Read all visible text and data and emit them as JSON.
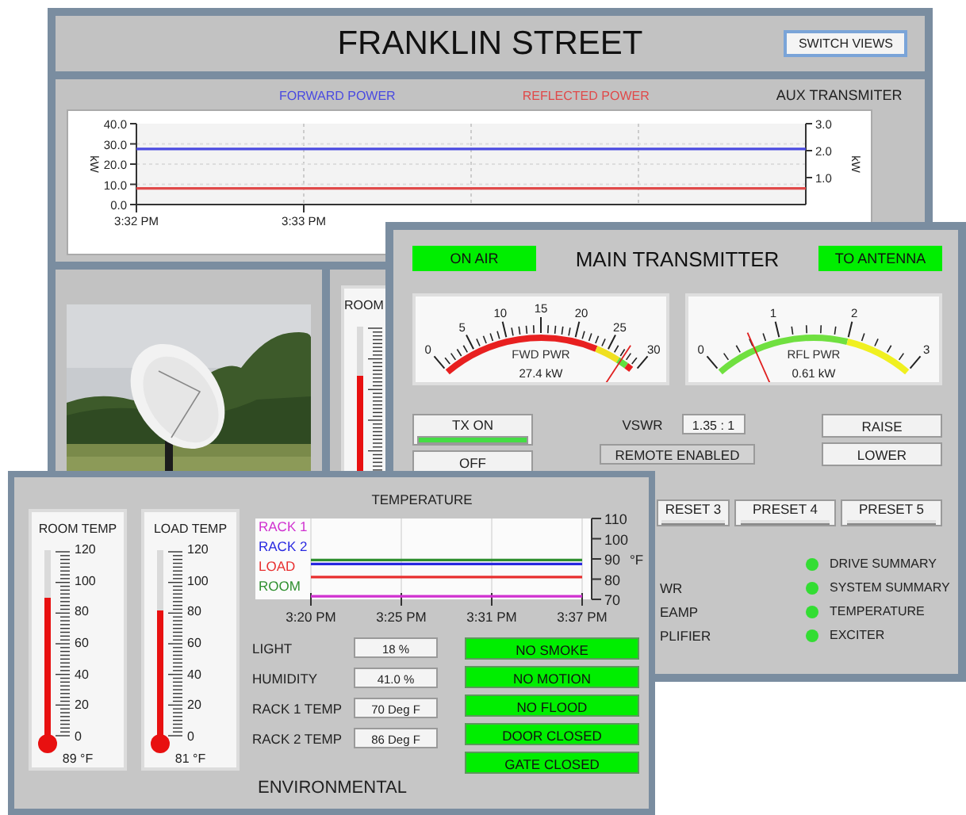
{
  "site_window": {
    "title": "FRANKLIN STREET",
    "switch_views_button": "SWITCH VIEWS",
    "aux_transmitter": {
      "title": "AUX TRANSMITER",
      "chart_data": {
        "type": "line",
        "grid": true,
        "ylabel": "kW",
        "y2label": "kW",
        "categories": [
          "3:32 PM",
          "3:33 PM",
          null,
          null,
          null
        ],
        "ylim": [
          0,
          40
        ],
        "yticks": [
          {
            "value": 0,
            "label": "0.0"
          },
          {
            "value": 10,
            "label": "10.0"
          },
          {
            "value": 20,
            "label": "20.0"
          },
          {
            "value": 30,
            "label": "30.0"
          },
          {
            "value": 40,
            "label": "40.0"
          }
        ],
        "y2lim": [
          0,
          3
        ],
        "y2ticks": [
          {
            "value": 1,
            "label": "1.0"
          },
          {
            "value": 2,
            "label": "2.0"
          },
          {
            "value": 3,
            "label": "3.0"
          }
        ],
        "series": [
          {
            "name": "FORWARD POWER",
            "color": "#4a4ae0",
            "values": [
              27.5,
              27.5,
              27.5,
              27.5,
              27.5
            ]
          },
          {
            "name": "REFLECTED POWER",
            "color": "#e04a4a",
            "axis": "y2",
            "values": [
              0.6,
              0.6,
              0.6,
              0.6,
              0.6
            ]
          }
        ]
      }
    },
    "room_thermometer": {
      "label": "ROOM",
      "level": 0.74
    }
  },
  "transmitter_window": {
    "title": "MAIN TRANSMITTER",
    "on_air": {
      "label": "ON AIR",
      "on": true
    },
    "to_antenna": {
      "label": "TO ANTENNA",
      "on": true
    },
    "gauges": [
      {
        "kind": "forward",
        "label": "FWD PWR",
        "reading": "27.4 kW",
        "ticks": [
          "0",
          "5",
          "10",
          "15",
          "20",
          "25",
          "30"
        ]
      },
      {
        "kind": "reflected",
        "label": "RFL PWR",
        "reading": "0.61 kW",
        "ticks": [
          "0",
          "1",
          "2",
          "3"
        ]
      }
    ],
    "tx_on_button": {
      "label": "TX ON",
      "on": true
    },
    "off_button": "OFF",
    "vswr_label": "VSWR",
    "vswr_value": "1.35 : 1",
    "remote_button": "REMOTE ENABLED",
    "raise_button": "RAISE",
    "lower_button": "LOWER",
    "presets": [
      {
        "label": "RESET 3",
        "on": false
      },
      {
        "label": "PRESET 4",
        "on": false
      },
      {
        "label": "PRESET 5",
        "on": false
      }
    ],
    "partial_labels": [
      "WR",
      "EAMP",
      "PLIFIER"
    ],
    "status_lights": [
      {
        "label": "DRIVE SUMMARY",
        "on": true
      },
      {
        "label": "SYSTEM SUMMARY",
        "on": true
      },
      {
        "label": "TEMPERATURE",
        "on": true
      },
      {
        "label": "EXCITER",
        "on": true
      }
    ]
  },
  "environment_window": {
    "title": "ENVIRONMENTAL",
    "thermometers": [
      {
        "label": "ROOM TEMP",
        "level": 0.742,
        "reading": "89 °F",
        "ticks": [
          "120",
          "100",
          "80",
          "60",
          "40",
          "20",
          "0"
        ]
      },
      {
        "label": "LOAD TEMP",
        "level": 0.675,
        "reading": "81 °F",
        "ticks": [
          "120",
          "100",
          "80",
          "60",
          "40",
          "20",
          "0"
        ]
      }
    ],
    "temperature_chart": {
      "title": "TEMPERATURE",
      "chart_data": {
        "type": "line",
        "grid": true,
        "ylabel": "°F",
        "categories": [
          "3:20 PM",
          "3:25 PM",
          "3:31 PM",
          "3:37 PM"
        ],
        "ylim": [
          70,
          110
        ],
        "yticks": [
          70,
          80,
          90,
          100,
          110
        ],
        "series": [
          {
            "name": "RACK 1",
            "color": "#d030d0",
            "values": [
              71.5,
              71.5,
              71.5,
              71.5
            ]
          },
          {
            "name": "RACK 2",
            "color": "#2828e0",
            "values": [
              87.5,
              87.5,
              87.5,
              87.5
            ]
          },
          {
            "name": "LOAD",
            "color": "#e83030",
            "values": [
              81,
              81,
              81,
              81
            ]
          },
          {
            "name": "ROOM",
            "color": "#309030",
            "values": [
              89.5,
              89.5,
              89.5,
              89.5
            ]
          }
        ]
      }
    },
    "readings": [
      {
        "label": "LIGHT",
        "value": "18 %"
      },
      {
        "label": "HUMIDITY",
        "value": "41.0 %"
      },
      {
        "label": "RACK 1 TEMP",
        "value": "70 Deg F"
      },
      {
        "label": "RACK 2 TEMP",
        "value": "86 Deg F"
      }
    ],
    "alarms": [
      {
        "label": "NO SMOKE",
        "alarm": false
      },
      {
        "label": "NO MOTION",
        "alarm": false
      },
      {
        "label": "NO FLOOD",
        "alarm": false
      },
      {
        "label": "DOOR CLOSED",
        "alarm": false
      },
      {
        "label": "GATE CLOSED",
        "alarm": false
      }
    ]
  }
}
